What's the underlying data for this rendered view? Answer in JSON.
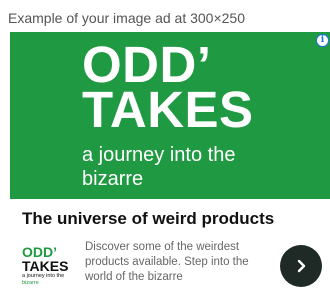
{
  "caption": "Example of your image ad at 300×250",
  "ad": {
    "hero": {
      "title_line1": "ODD’",
      "title_line2": "TAKES",
      "tagline_line1": "a journey into the",
      "tagline_line2": "bizarre",
      "background_color": "#209943"
    },
    "adchoices_icon": "info-icon",
    "headline": "The universe of weird products",
    "mini_logo": {
      "line1": "ODD’",
      "line2": "TAKES",
      "line3": "a journey into the",
      "line4": "bizarre"
    },
    "description": "Discover some of the weirdest products available. Step into the world of the bizarre",
    "next_button_icon": "chevron-right-icon",
    "button_color": "#1f2a26"
  }
}
